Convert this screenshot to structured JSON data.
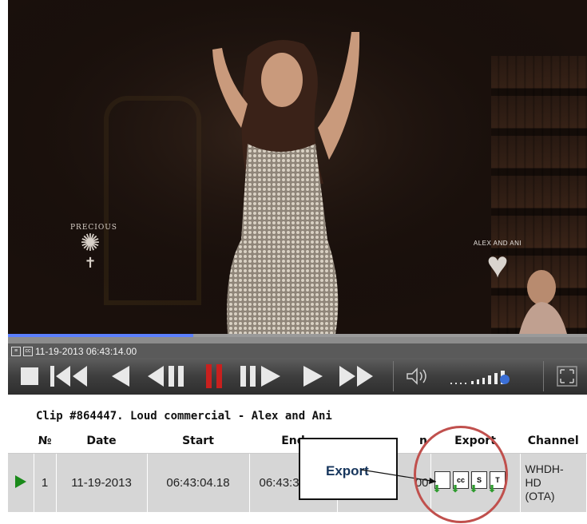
{
  "video": {
    "watermark_left_text": "PRECIOUS",
    "watermark_right_text": "ALEX AND ANI",
    "progress_fraction": 0.32,
    "timestamp": "11-19-2013 06:43:14.00",
    "timestamp_cc_icon": "cc-icon",
    "timestamp_list_icon": "list-icon"
  },
  "controls": {
    "buttons": [
      "stop-icon",
      "rewind-fast-icon",
      "step-back-icon",
      "frame-back-icon",
      "pause-icon",
      "frame-forward-icon",
      "play-icon",
      "fast-forward-icon",
      "volume-icon",
      "volume-level-icon",
      "fullscreen-icon"
    ],
    "accent_pause": "#c8201e",
    "icon_color": "#e8e8e8"
  },
  "clip": {
    "title": "Clip #864447. Loud commercial - Alex and Ani",
    "headers": [
      "№",
      "Date",
      "Start",
      "End",
      "n",
      "Export",
      "Channel"
    ],
    "rows": [
      {
        "num": "1",
        "date": "11-19-2013",
        "start": "06:43:04.18",
        "end": "06:43:34",
        "duration_fragment": "00",
        "channel": "WHDH-HD (OTA)",
        "channel_lines": [
          "WHDH-",
          "HD",
          "(OTA)"
        ]
      }
    ],
    "export_icons": [
      {
        "name": "document-export-icon",
        "label": ""
      },
      {
        "name": "cc-export-icon",
        "label": "cc"
      },
      {
        "name": "s-export-icon",
        "label": "S"
      },
      {
        "name": "t-export-icon",
        "label": "T"
      }
    ]
  },
  "annotation": {
    "callout_label": "Export",
    "highlight_color": "#c0504d"
  }
}
